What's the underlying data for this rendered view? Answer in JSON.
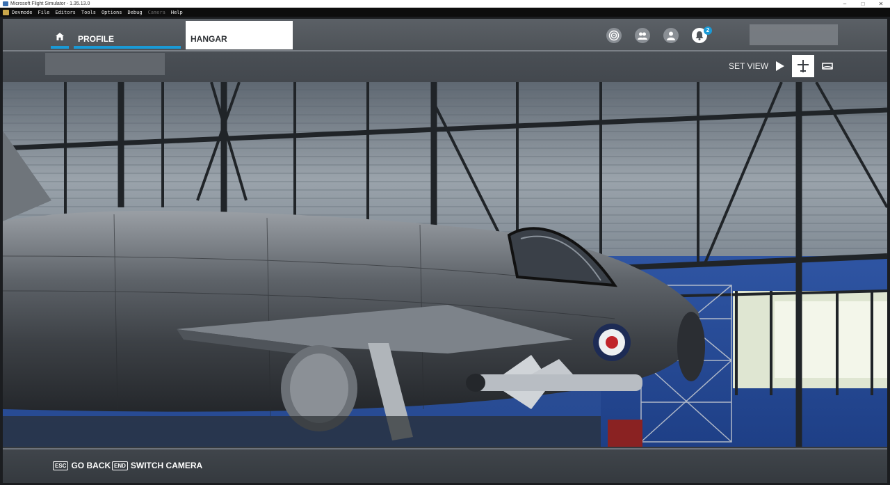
{
  "window": {
    "title": "Microsoft Flight Simulator - 1.35.13.0",
    "controls": [
      "minimize-icon",
      "maximize-icon",
      "close-icon"
    ]
  },
  "devmenu": {
    "items": [
      {
        "label": "Devmode",
        "enabled": true
      },
      {
        "label": "File",
        "enabled": true
      },
      {
        "label": "Editors",
        "enabled": true
      },
      {
        "label": "Tools",
        "enabled": true
      },
      {
        "label": "Options",
        "enabled": true
      },
      {
        "label": "Debug",
        "enabled": true
      },
      {
        "label": "Camera",
        "enabled": false
      },
      {
        "label": "Help",
        "enabled": true
      }
    ]
  },
  "topnav": {
    "home_icon": "home-icon",
    "tabs": [
      {
        "label": "PROFILE",
        "selected": true
      },
      {
        "label": "HANGAR",
        "active": true
      }
    ],
    "icons": [
      "activity-icon",
      "friends-icon",
      "user-icon",
      "bell-icon"
    ],
    "notification_count": "2"
  },
  "subbar": {
    "set_view_label": "SET VIEW",
    "view_buttons": [
      {
        "icon": "play-icon",
        "active": false
      },
      {
        "icon": "airplane-icon",
        "active": true
      },
      {
        "icon": "cockpit-icon",
        "active": false
      }
    ]
  },
  "bottombar": {
    "actions": [
      {
        "key": "ESC",
        "label": "GO BACK"
      },
      {
        "key": "END",
        "label": "SWITCH CAMERA"
      }
    ]
  },
  "colors": {
    "accent": "#1a9ad6",
    "hangar_blue": "#264a96",
    "frame_gray": "#35393e"
  }
}
